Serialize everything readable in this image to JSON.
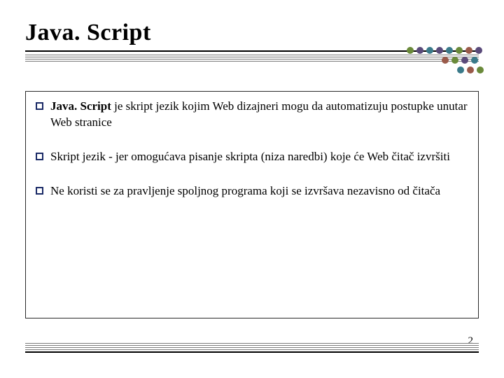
{
  "title": "Java. Script",
  "bullets": [
    {
      "bold": "Java. Script ",
      "rest": "je skript jezik kojim Web dizajneri mogu da automatizuju postupke unutar Web stranice"
    },
    {
      "bold": "",
      "rest": "Skript jezik - jer omogućava pisanje skripta (niza naredbi) koje će Web čitač izvršiti"
    },
    {
      "bold": "",
      "rest": "Ne koristi se za pravljenje spoljnog programa koji se izvršava nezavisno od čitača"
    }
  ],
  "page_number": "2",
  "dot_colors": {
    "green": "#6a8a3a",
    "purple": "#5a4a7a",
    "teal": "#3a7a8a",
    "rose": "#9a5a4a"
  }
}
